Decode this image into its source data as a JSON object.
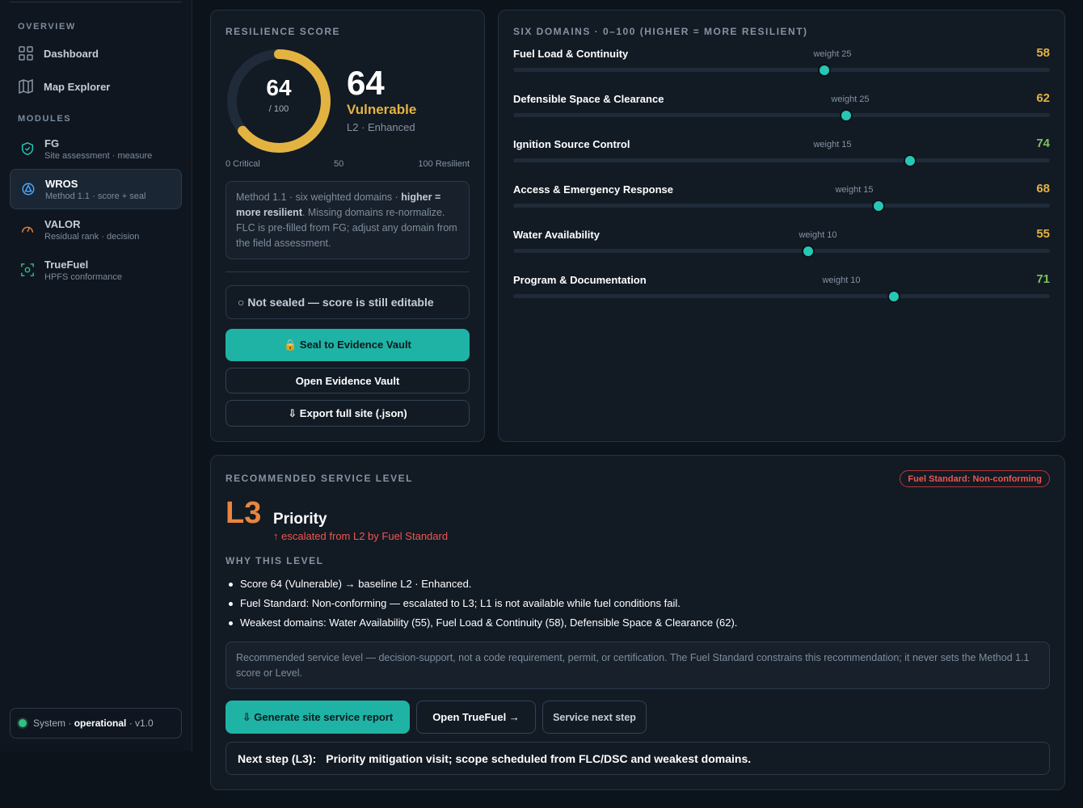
{
  "sidebar": {
    "overview_heading": "OVERVIEW",
    "nav": [
      {
        "label": "Dashboard",
        "icon": "grid-icon"
      },
      {
        "label": "Map Explorer",
        "icon": "map-icon"
      }
    ],
    "modules_heading": "MODULES",
    "modules": [
      {
        "name": "FG",
        "sub": "Site assessment · measure",
        "icon": "shield-icon",
        "active": false
      },
      {
        "name": "WROS",
        "sub": "Method 1.1 · score + seal",
        "icon": "target-icon",
        "active": true
      },
      {
        "name": "VALOR",
        "sub": "Residual rank · decision",
        "icon": "gauge-icon",
        "active": false
      },
      {
        "name": "TrueFuel",
        "sub": "HPFS conformance",
        "icon": "scan-icon",
        "active": false
      }
    ],
    "system": {
      "prefix": "System ·",
      "state": "operational",
      "version": "· v1.0"
    }
  },
  "score": {
    "title": "RESILIENCE SCORE",
    "value": 64,
    "value_text": "64",
    "denominator": "/ 100",
    "status": "Vulnerable",
    "level": "L2 · Enhanced",
    "scale_left": "0 Critical",
    "scale_mid": "50",
    "scale_right": "100 Resilient",
    "note_part1": "Method 1.1 · six weighted domains · ",
    "note_bold": "higher = more resilient",
    "note_part2": ". Missing domains re-normalize. FLC is pre-filled from FG; adjust any domain from the field assessment.",
    "seal_status": "○ Not sealed — score is still editable",
    "seal_button": "🔒 Seal to Evidence Vault",
    "vault_button": "Open Evidence Vault",
    "export_button": "⇩ Export full site (.json)",
    "gauge_color": "#e3b341"
  },
  "domains": {
    "title": "SIX DOMAINS · 0–100 (HIGHER = MORE RESILIENT)",
    "items": [
      {
        "name": "Fuel Load & Continuity",
        "weight": "weight 25",
        "value": 58,
        "value_text": "58",
        "color": "#e3b341"
      },
      {
        "name": "Defensible Space & Clearance",
        "weight": "weight 25",
        "value": 62,
        "value_text": "62",
        "color": "#e3b341"
      },
      {
        "name": "Ignition Source Control",
        "weight": "weight 15",
        "value": 74,
        "value_text": "74",
        "color": "#7ec160"
      },
      {
        "name": "Access & Emergency Response",
        "weight": "weight 15",
        "value": 68,
        "value_text": "68",
        "color": "#e3b341"
      },
      {
        "name": "Water Availability",
        "weight": "weight 10",
        "value": 55,
        "value_text": "55",
        "color": "#e3b341"
      },
      {
        "name": "Program & Documentation",
        "weight": "weight 10",
        "value": 71,
        "value_text": "71",
        "color": "#7ec160"
      }
    ]
  },
  "service": {
    "title": "RECOMMENDED SERVICE LEVEL",
    "badge": "Fuel Standard: Non-conforming",
    "level_code": "L3",
    "level_name": "Priority",
    "escalation": "↑ escalated from L2 by Fuel Standard",
    "why_title": "WHY THIS LEVEL",
    "reasons": [
      "Score 64 (Vulnerable) → baseline L2 · Enhanced.",
      "Fuel Standard: Non-conforming — escalated to L3; L1 is not available while fuel conditions fail.",
      "Weakest domains: Water Availability (55), Fuel Load & Continuity (58), Defensible Space & Clearance (62)."
    ],
    "disclaimer": "Recommended service level — decision-support, not a code requirement, permit, or certification. The Fuel Standard constrains this recommendation; it never sets the Method 1.1 score or Level.",
    "btn_report": "⇩ Generate site service report",
    "btn_truefuel": "Open TrueFuel →",
    "btn_next": "Service next step",
    "next_label": "Next step (L3):",
    "next_text": "Priority mitigation visit; scope scheduled from FLC/DSC and weakest domains."
  }
}
